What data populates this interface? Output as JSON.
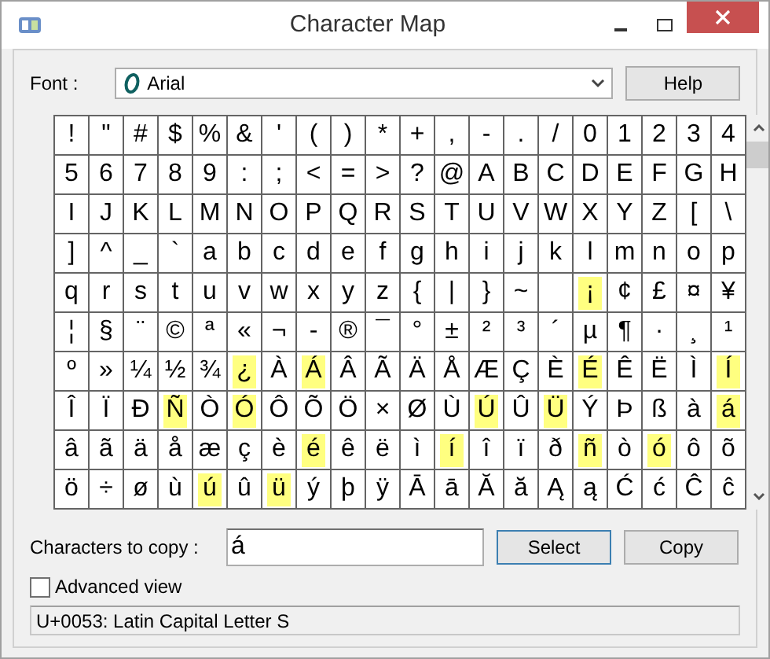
{
  "window": {
    "title": "Character Map"
  },
  "font": {
    "label": "Font :",
    "value": "Arial",
    "help": "Help"
  },
  "grid": {
    "rows": [
      [
        {
          "ch": "!",
          "highlighted": false
        },
        {
          "ch": "\"",
          "highlighted": false
        },
        {
          "ch": "#",
          "highlighted": false
        },
        {
          "ch": "$",
          "highlighted": false
        },
        {
          "ch": "%",
          "highlighted": false
        },
        {
          "ch": "&",
          "highlighted": false
        },
        {
          "ch": "'",
          "highlighted": false
        },
        {
          "ch": "(",
          "highlighted": false
        },
        {
          "ch": ")",
          "highlighted": false
        },
        {
          "ch": "*",
          "highlighted": false
        },
        {
          "ch": "+",
          "highlighted": false
        },
        {
          "ch": ",",
          "highlighted": false
        },
        {
          "ch": "-",
          "highlighted": false
        },
        {
          "ch": ".",
          "highlighted": false
        },
        {
          "ch": "/",
          "highlighted": false
        },
        {
          "ch": "0",
          "highlighted": false
        },
        {
          "ch": "1",
          "highlighted": false
        },
        {
          "ch": "2",
          "highlighted": false
        },
        {
          "ch": "3",
          "highlighted": false
        },
        {
          "ch": "4",
          "highlighted": false
        }
      ],
      [
        {
          "ch": "5",
          "highlighted": false
        },
        {
          "ch": "6",
          "highlighted": false
        },
        {
          "ch": "7",
          "highlighted": false
        },
        {
          "ch": "8",
          "highlighted": false
        },
        {
          "ch": "9",
          "highlighted": false
        },
        {
          "ch": ":",
          "highlighted": false
        },
        {
          "ch": ";",
          "highlighted": false
        },
        {
          "ch": "<",
          "highlighted": false
        },
        {
          "ch": "=",
          "highlighted": false
        },
        {
          "ch": ">",
          "highlighted": false
        },
        {
          "ch": "?",
          "highlighted": false
        },
        {
          "ch": "@",
          "highlighted": false
        },
        {
          "ch": "A",
          "highlighted": false
        },
        {
          "ch": "B",
          "highlighted": false
        },
        {
          "ch": "C",
          "highlighted": false
        },
        {
          "ch": "D",
          "highlighted": false
        },
        {
          "ch": "E",
          "highlighted": false
        },
        {
          "ch": "F",
          "highlighted": false
        },
        {
          "ch": "G",
          "highlighted": false
        },
        {
          "ch": "H",
          "highlighted": false
        }
      ],
      [
        {
          "ch": "I",
          "highlighted": false
        },
        {
          "ch": "J",
          "highlighted": false
        },
        {
          "ch": "K",
          "highlighted": false
        },
        {
          "ch": "L",
          "highlighted": false
        },
        {
          "ch": "M",
          "highlighted": false
        },
        {
          "ch": "N",
          "highlighted": false
        },
        {
          "ch": "O",
          "highlighted": false
        },
        {
          "ch": "P",
          "highlighted": false
        },
        {
          "ch": "Q",
          "highlighted": false
        },
        {
          "ch": "R",
          "highlighted": false
        },
        {
          "ch": "S",
          "highlighted": false
        },
        {
          "ch": "T",
          "highlighted": false
        },
        {
          "ch": "U",
          "highlighted": false
        },
        {
          "ch": "V",
          "highlighted": false
        },
        {
          "ch": "W",
          "highlighted": false
        },
        {
          "ch": "X",
          "highlighted": false
        },
        {
          "ch": "Y",
          "highlighted": false
        },
        {
          "ch": "Z",
          "highlighted": false
        },
        {
          "ch": "[",
          "highlighted": false
        },
        {
          "ch": "\\",
          "highlighted": false
        }
      ],
      [
        {
          "ch": "]",
          "highlighted": false
        },
        {
          "ch": "^",
          "highlighted": false
        },
        {
          "ch": "_",
          "highlighted": false
        },
        {
          "ch": "`",
          "highlighted": false
        },
        {
          "ch": "a",
          "highlighted": false
        },
        {
          "ch": "b",
          "highlighted": false
        },
        {
          "ch": "c",
          "highlighted": false
        },
        {
          "ch": "d",
          "highlighted": false
        },
        {
          "ch": "e",
          "highlighted": false
        },
        {
          "ch": "f",
          "highlighted": false
        },
        {
          "ch": "g",
          "highlighted": false
        },
        {
          "ch": "h",
          "highlighted": false
        },
        {
          "ch": "i",
          "highlighted": false
        },
        {
          "ch": "j",
          "highlighted": false
        },
        {
          "ch": "k",
          "highlighted": false
        },
        {
          "ch": "l",
          "highlighted": false
        },
        {
          "ch": "m",
          "highlighted": false
        },
        {
          "ch": "n",
          "highlighted": false
        },
        {
          "ch": "o",
          "highlighted": false
        },
        {
          "ch": "p",
          "highlighted": false
        }
      ],
      [
        {
          "ch": "q",
          "highlighted": false
        },
        {
          "ch": "r",
          "highlighted": false
        },
        {
          "ch": "s",
          "highlighted": false
        },
        {
          "ch": "t",
          "highlighted": false
        },
        {
          "ch": "u",
          "highlighted": false
        },
        {
          "ch": "v",
          "highlighted": false
        },
        {
          "ch": "w",
          "highlighted": false
        },
        {
          "ch": "x",
          "highlighted": false
        },
        {
          "ch": "y",
          "highlighted": false
        },
        {
          "ch": "z",
          "highlighted": false
        },
        {
          "ch": "{",
          "highlighted": false
        },
        {
          "ch": "|",
          "highlighted": false
        },
        {
          "ch": "}",
          "highlighted": false
        },
        {
          "ch": "~",
          "highlighted": false
        },
        {
          "highlighted": false
        },
        {
          "ch": "¡",
          "highlighted": true
        },
        {
          "ch": "¢",
          "highlighted": false
        },
        {
          "ch": "£",
          "highlighted": false
        },
        {
          "ch": "¤",
          "highlighted": false
        },
        {
          "ch": "¥",
          "highlighted": false
        }
      ],
      [
        {
          "ch": "¦",
          "highlighted": false
        },
        {
          "ch": "§",
          "highlighted": false
        },
        {
          "ch": "¨",
          "highlighted": false
        },
        {
          "ch": "©",
          "highlighted": false
        },
        {
          "ch": "ª",
          "highlighted": false
        },
        {
          "ch": "«",
          "highlighted": false
        },
        {
          "ch": "¬",
          "highlighted": false
        },
        {
          "ch": "-",
          "highlighted": false
        },
        {
          "ch": "®",
          "highlighted": false
        },
        {
          "ch": "¯",
          "highlighted": false
        },
        {
          "ch": "°",
          "highlighted": false
        },
        {
          "ch": "±",
          "highlighted": false
        },
        {
          "ch": "²",
          "highlighted": false
        },
        {
          "ch": "³",
          "highlighted": false
        },
        {
          "ch": "´",
          "highlighted": false
        },
        {
          "ch": "µ",
          "highlighted": false
        },
        {
          "ch": "¶",
          "highlighted": false
        },
        {
          "ch": "·",
          "highlighted": false
        },
        {
          "ch": "¸",
          "highlighted": false
        },
        {
          "ch": "¹",
          "highlighted": false
        }
      ],
      [
        {
          "ch": "º",
          "highlighted": false
        },
        {
          "ch": "»",
          "highlighted": false
        },
        {
          "ch": "¼",
          "highlighted": false
        },
        {
          "ch": "½",
          "highlighted": false
        },
        {
          "ch": "¾",
          "highlighted": false
        },
        {
          "ch": "¿",
          "highlighted": true
        },
        {
          "ch": "À",
          "highlighted": false
        },
        {
          "ch": "Á",
          "highlighted": true
        },
        {
          "ch": "Â",
          "highlighted": false
        },
        {
          "ch": "Ã",
          "highlighted": false
        },
        {
          "ch": "Ä",
          "highlighted": false
        },
        {
          "ch": "Å",
          "highlighted": false
        },
        {
          "ch": "Æ",
          "highlighted": false
        },
        {
          "ch": "Ç",
          "highlighted": false
        },
        {
          "ch": "È",
          "highlighted": false
        },
        {
          "ch": "É",
          "highlighted": true
        },
        {
          "ch": "Ê",
          "highlighted": false
        },
        {
          "ch": "Ë",
          "highlighted": false
        },
        {
          "ch": "Ì",
          "highlighted": false
        },
        {
          "ch": "Í",
          "highlighted": true
        }
      ],
      [
        {
          "ch": "Î",
          "highlighted": false
        },
        {
          "ch": "Ï",
          "highlighted": false
        },
        {
          "ch": "Ð",
          "highlighted": false
        },
        {
          "ch": "Ñ",
          "highlighted": true
        },
        {
          "ch": "Ò",
          "highlighted": false
        },
        {
          "ch": "Ó",
          "highlighted": true
        },
        {
          "ch": "Ô",
          "highlighted": false
        },
        {
          "ch": "Õ",
          "highlighted": false
        },
        {
          "ch": "Ö",
          "highlighted": false
        },
        {
          "ch": "×",
          "highlighted": false
        },
        {
          "ch": "Ø",
          "highlighted": false
        },
        {
          "ch": "Ù",
          "highlighted": false
        },
        {
          "ch": "Ú",
          "highlighted": true
        },
        {
          "ch": "Û",
          "highlighted": false
        },
        {
          "ch": "Ü",
          "highlighted": true
        },
        {
          "ch": "Ý",
          "highlighted": false
        },
        {
          "ch": "Þ",
          "highlighted": false
        },
        {
          "ch": "ß",
          "highlighted": false
        },
        {
          "ch": "à",
          "highlighted": false
        },
        {
          "ch": "á",
          "highlighted": true
        }
      ],
      [
        {
          "ch": "â",
          "highlighted": false
        },
        {
          "ch": "ã",
          "highlighted": false
        },
        {
          "ch": "ä",
          "highlighted": false
        },
        {
          "ch": "å",
          "highlighted": false
        },
        {
          "ch": "æ",
          "highlighted": false
        },
        {
          "ch": "ç",
          "highlighted": false
        },
        {
          "ch": "è",
          "highlighted": false
        },
        {
          "ch": "é",
          "highlighted": true
        },
        {
          "ch": "ê",
          "highlighted": false
        },
        {
          "ch": "ë",
          "highlighted": false
        },
        {
          "ch": "ì",
          "highlighted": false
        },
        {
          "ch": "í",
          "highlighted": true
        },
        {
          "ch": "î",
          "highlighted": false
        },
        {
          "ch": "ï",
          "highlighted": false
        },
        {
          "ch": "ð",
          "highlighted": false
        },
        {
          "ch": "ñ",
          "highlighted": true
        },
        {
          "ch": "ò",
          "highlighted": false
        },
        {
          "ch": "ó",
          "highlighted": true
        },
        {
          "ch": "ô",
          "highlighted": false
        },
        {
          "ch": "õ",
          "highlighted": false
        }
      ],
      [
        {
          "ch": "ö",
          "highlighted": false
        },
        {
          "ch": "÷",
          "highlighted": false
        },
        {
          "ch": "ø",
          "highlighted": false
        },
        {
          "ch": "ù",
          "highlighted": false
        },
        {
          "ch": "ú",
          "highlighted": true
        },
        {
          "ch": "û",
          "highlighted": false
        },
        {
          "ch": "ü",
          "highlighted": true
        },
        {
          "ch": "ý",
          "highlighted": false
        },
        {
          "ch": "þ",
          "highlighted": false
        },
        {
          "ch": "ÿ",
          "highlighted": false
        },
        {
          "ch": "Ā",
          "highlighted": false
        },
        {
          "ch": "ā",
          "highlighted": false
        },
        {
          "ch": "Ă",
          "highlighted": false
        },
        {
          "ch": "ă",
          "highlighted": false
        },
        {
          "ch": "Ą",
          "highlighted": false
        },
        {
          "ch": "ą",
          "highlighted": false
        },
        {
          "ch": "Ć",
          "highlighted": false
        },
        {
          "ch": "ć",
          "highlighted": false
        },
        {
          "ch": "Ĉ",
          "highlighted": false
        },
        {
          "ch": "ĉ",
          "highlighted": false
        }
      ]
    ]
  },
  "copy": {
    "label": "Characters to copy :",
    "value": "á",
    "select": "Select",
    "copy": "Copy"
  },
  "advanced": {
    "label": "Advanced view",
    "checked": false
  },
  "status_bar": "U+0053: Latin Capital Letter S"
}
